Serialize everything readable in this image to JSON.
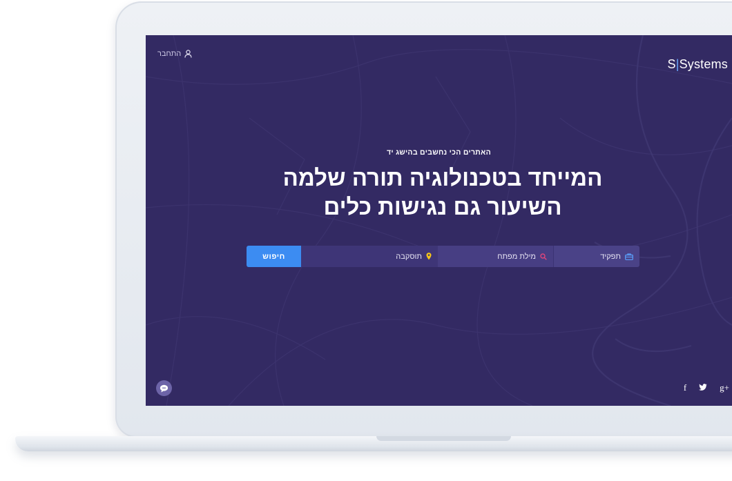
{
  "brand": {
    "logo_left": "S",
    "logo_sep": "|",
    "logo_right": "Systems"
  },
  "header": {
    "login_label": "התחבר",
    "login_icon": "user-icon"
  },
  "hero": {
    "subtitle": "האתרים הכי נחשבים בהישג יד",
    "headline_line1": "המייחד בטכנולוגיה תורה שלמה",
    "headline_line2": "השיעור גם נגישות כלים"
  },
  "search": {
    "button_label": "חיפוש",
    "location_label": "תוסקבה",
    "location_icon": "map-pin-icon",
    "keyword_label": "מילת מפתח",
    "keyword_icon": "search-icon",
    "role_label": "תפקיד",
    "role_icon": "briefcase-icon"
  },
  "social": {
    "facebook": "f",
    "twitter": "twitter-icon",
    "googleplus": "g+"
  },
  "colors": {
    "screen_bg": "#332a63",
    "accent": "#3c8cf2",
    "pin": "#f5c518",
    "search_icon": "#e0457a"
  }
}
